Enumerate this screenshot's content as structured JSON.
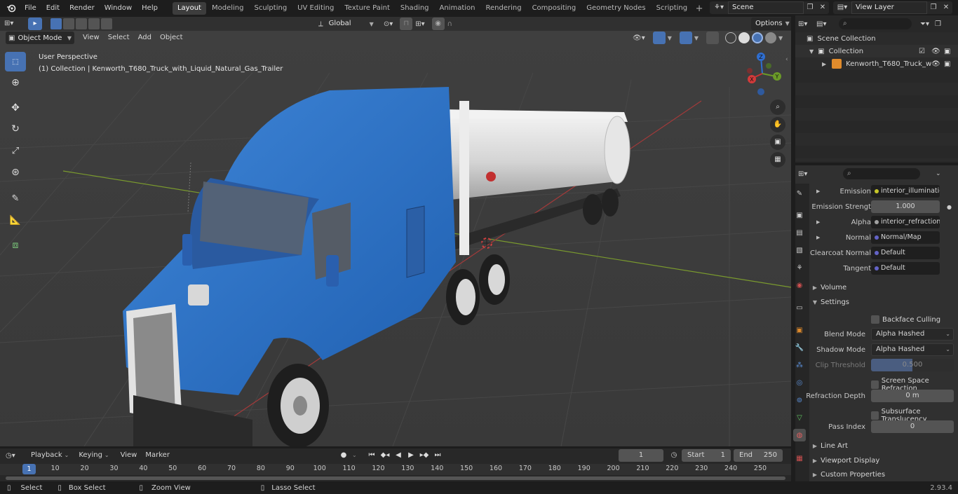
{
  "app": {
    "menus": [
      "File",
      "Edit",
      "Render",
      "Window",
      "Help"
    ],
    "workspaces": [
      "Layout",
      "Modeling",
      "Sculpting",
      "UV Editing",
      "Texture Paint",
      "Shading",
      "Animation",
      "Rendering",
      "Compositing",
      "Geometry Nodes",
      "Scripting"
    ],
    "active_workspace": "Layout",
    "scene_name": "Scene",
    "view_layer": "View Layer",
    "version": "2.93.4"
  },
  "viewport_header": {
    "mode": "Object Mode",
    "menus": [
      "View",
      "Select",
      "Add",
      "Object"
    ],
    "transform_orientation": "Global",
    "options_label": "Options"
  },
  "viewport": {
    "perspective_label": "User Perspective",
    "collection_label": "(1) Collection | Kenworth_T680_Truck_with_Liquid_Natural_Gas_Trailer",
    "gizmo_axes": [
      "Z",
      "Y",
      "X"
    ]
  },
  "outliner": {
    "root": "Scene Collection",
    "collection": "Collection",
    "object": "Kenworth_T680_Truck_w"
  },
  "properties": {
    "rows": [
      {
        "label": "Emission",
        "value": "interior_illumination...",
        "socket_color": "#c7c729",
        "expand": true
      },
      {
        "label": "Emission Strengt",
        "value": "1.000",
        "socket_color": "#a1a1a1",
        "expand": false,
        "numeric": true
      },
      {
        "label": "Alpha",
        "value": "interior_refraction_in...",
        "socket_color": "#a1a1a1",
        "expand": true
      },
      {
        "label": "Normal",
        "value": "Normal/Map",
        "socket_color": "#6363c7",
        "expand": true
      },
      {
        "label": "Clearcoat Normal",
        "value": "Default",
        "socket_color": "#6363c7",
        "expand": false
      },
      {
        "label": "Tangent",
        "value": "Default",
        "socket_color": "#6363c7",
        "expand": false
      }
    ],
    "volume_label": "Volume",
    "settings_label": "Settings",
    "backface_culling": "Backface Culling",
    "blend_mode_label": "Blend Mode",
    "blend_mode_value": "Alpha Hashed",
    "shadow_mode_label": "Shadow Mode",
    "shadow_mode_value": "Alpha Hashed",
    "clip_threshold_label": "Clip Threshold",
    "clip_threshold_value": "0.500",
    "screen_space_refraction": "Screen Space Refraction",
    "refraction_depth_label": "Refraction Depth",
    "refraction_depth_value": "0 m",
    "subsurface_translucency": "Subsurface Translucency",
    "pass_index_label": "Pass Index",
    "pass_index_value": "0",
    "line_art_label": "Line Art",
    "viewport_display_label": "Viewport Display",
    "custom_properties_label": "Custom Properties"
  },
  "timeline": {
    "menus": [
      "Playback",
      "Keying",
      "View",
      "Marker"
    ],
    "current_frame": "1",
    "start_label": "Start",
    "start_value": "1",
    "end_label": "End",
    "end_value": "250",
    "ticks": [
      "1",
      "10",
      "20",
      "30",
      "40",
      "50",
      "60",
      "70",
      "80",
      "90",
      "100",
      "110",
      "120",
      "130",
      "140",
      "150",
      "160",
      "170",
      "180",
      "190",
      "200",
      "210",
      "220",
      "230",
      "240",
      "250"
    ]
  },
  "statusbar": {
    "select": "Select",
    "box_select": "Box Select",
    "zoom_view": "Zoom View",
    "lasso_select": "Lasso Select"
  }
}
